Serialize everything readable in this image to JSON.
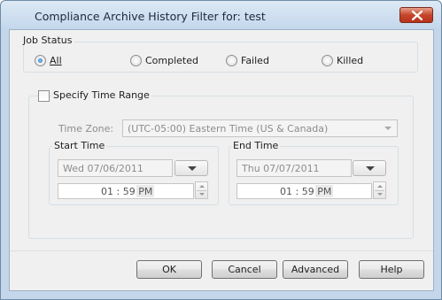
{
  "window": {
    "title": "Compliance Archive History Filter for: test",
    "close_icon": "close-icon"
  },
  "job_status": {
    "legend": "Job Status",
    "options": [
      {
        "label": "All",
        "selected": true
      },
      {
        "label": "Completed",
        "selected": false
      },
      {
        "label": "Failed",
        "selected": false
      },
      {
        "label": "Killed",
        "selected": false
      }
    ]
  },
  "time_range": {
    "checkbox_label": "Specify Time Range",
    "checked": false,
    "time_zone_label": "Time Zone:",
    "time_zone_value": "(UTC-05:00) Eastern Time (US & Canada)",
    "start": {
      "legend": "Start Time",
      "date": "Wed 07/06/2011",
      "time": "01 : 59 PM"
    },
    "end": {
      "legend": "End Time",
      "date": "Thu 07/07/2011",
      "time": "01 : 59 PM"
    }
  },
  "buttons": {
    "ok": "OK",
    "cancel": "Cancel",
    "advanced": "Advanced",
    "help": "Help"
  }
}
